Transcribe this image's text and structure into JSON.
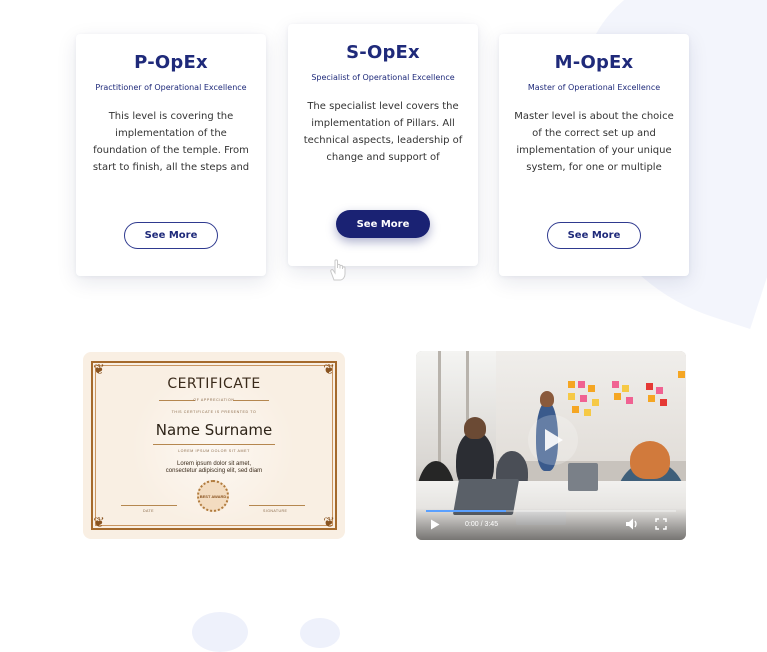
{
  "cards": [
    {
      "title": "P-OpEx",
      "subtitle": "Practitioner of Operational Excellence",
      "text": "This level is covering the implementation of the foundation of the temple. From start to finish, all the steps and key methods needed as well as how to hold the",
      "button": "See More"
    },
    {
      "title": "S-OpEx",
      "subtitle": "Specialist of Operational Excellence",
      "text": "The specialist level covers the implementation of Pillars. All technical aspects, leadership of change and support of Practitioner level work. You will be perfectly set",
      "button": "See More"
    },
    {
      "title": "M-OpEx",
      "subtitle": "Master of Operational Excellence",
      "text": "Master level is about the choice of the correct set up and implementation of your unique system, for one or multiple plants. It covers every aspect of how to",
      "button": "See More"
    }
  ],
  "certificate": {
    "title": "CERTIFICATE",
    "of_line": "OF APPRECIATION",
    "presented_line": "THIS CERTIFICATE IS PRESENTED TO",
    "name": "Name Surname",
    "sub_name": "LOREM IPSUM DOLOR SIT AMET",
    "description_line1": "Lorem ipsum dolor sit amet,",
    "description_line2": "consectetur adipiscing elit, sed diam",
    "seal_text": "BEST AWARD",
    "date_label": "DATE",
    "signature_label": "SIGNATURE",
    "colors": {
      "background": "#f9efe3",
      "frame": "#a56a2c"
    }
  },
  "video": {
    "time": "0:00 / 3:45",
    "progress": 0.32,
    "icons": {
      "play": "play-icon",
      "volume": "volume-icon",
      "fullscreen": "fullscreen-icon",
      "big_play": "big-play-icon"
    }
  },
  "colors": {
    "brand": "#1f2a7a",
    "button_primary": "#1a2273"
  }
}
